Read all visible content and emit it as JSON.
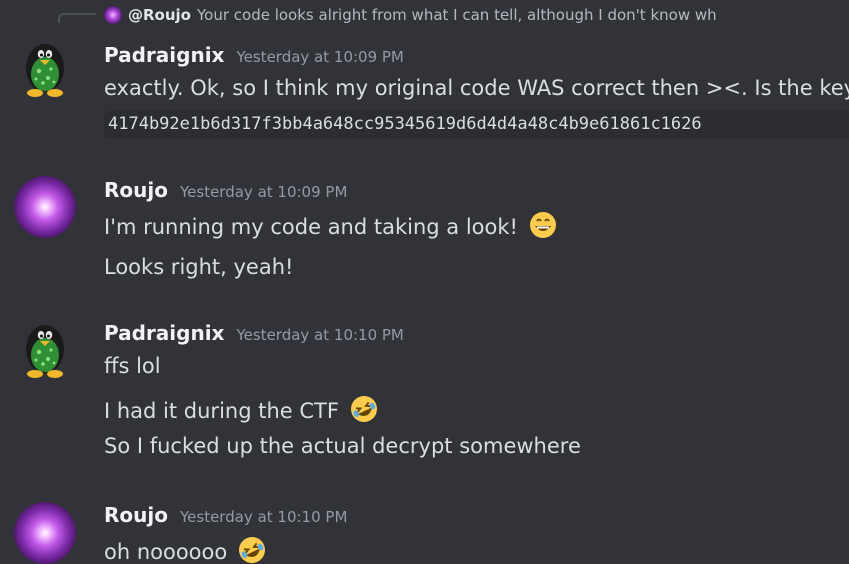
{
  "reply": {
    "author": "@Roujo",
    "text": "Your code looks alright from what I can tell, although I don't know wh"
  },
  "messages": [
    {
      "author": "Padraignix",
      "timestamp": "Yesterday at 10:09 PM",
      "lines": [
        "exactly. Ok, so I think my original code WAS correct then ><. Is the key"
      ],
      "code": "4174b92e1b6d317f3bb4a648cc95345619d6d4d4a48c4b9e61861c1626"
    },
    {
      "author": "Roujo",
      "timestamp": "Yesterday at 10:09 PM",
      "lines": [
        "I'm running my code and taking a look!",
        "Looks right, yeah!"
      ]
    },
    {
      "author": "Padraignix",
      "timestamp": "Yesterday at 10:10 PM",
      "lines": [
        "ffs lol",
        "I had it during the CTF",
        "So I fucked up the actual decrypt somewhere"
      ]
    },
    {
      "author": "Roujo",
      "timestamp": "Yesterday at 10:10 PM",
      "lines": [
        "oh noooooo"
      ]
    }
  ],
  "colors": {
    "background": "#313338",
    "text": "#dbdee1",
    "username": "#f2f3f5",
    "timestamp": "#949ba4",
    "code_background": "#2b2d31"
  },
  "icons": {
    "grin": "grinning-emoji-icon",
    "rofl": "rolling-laughing-emoji-icon"
  }
}
